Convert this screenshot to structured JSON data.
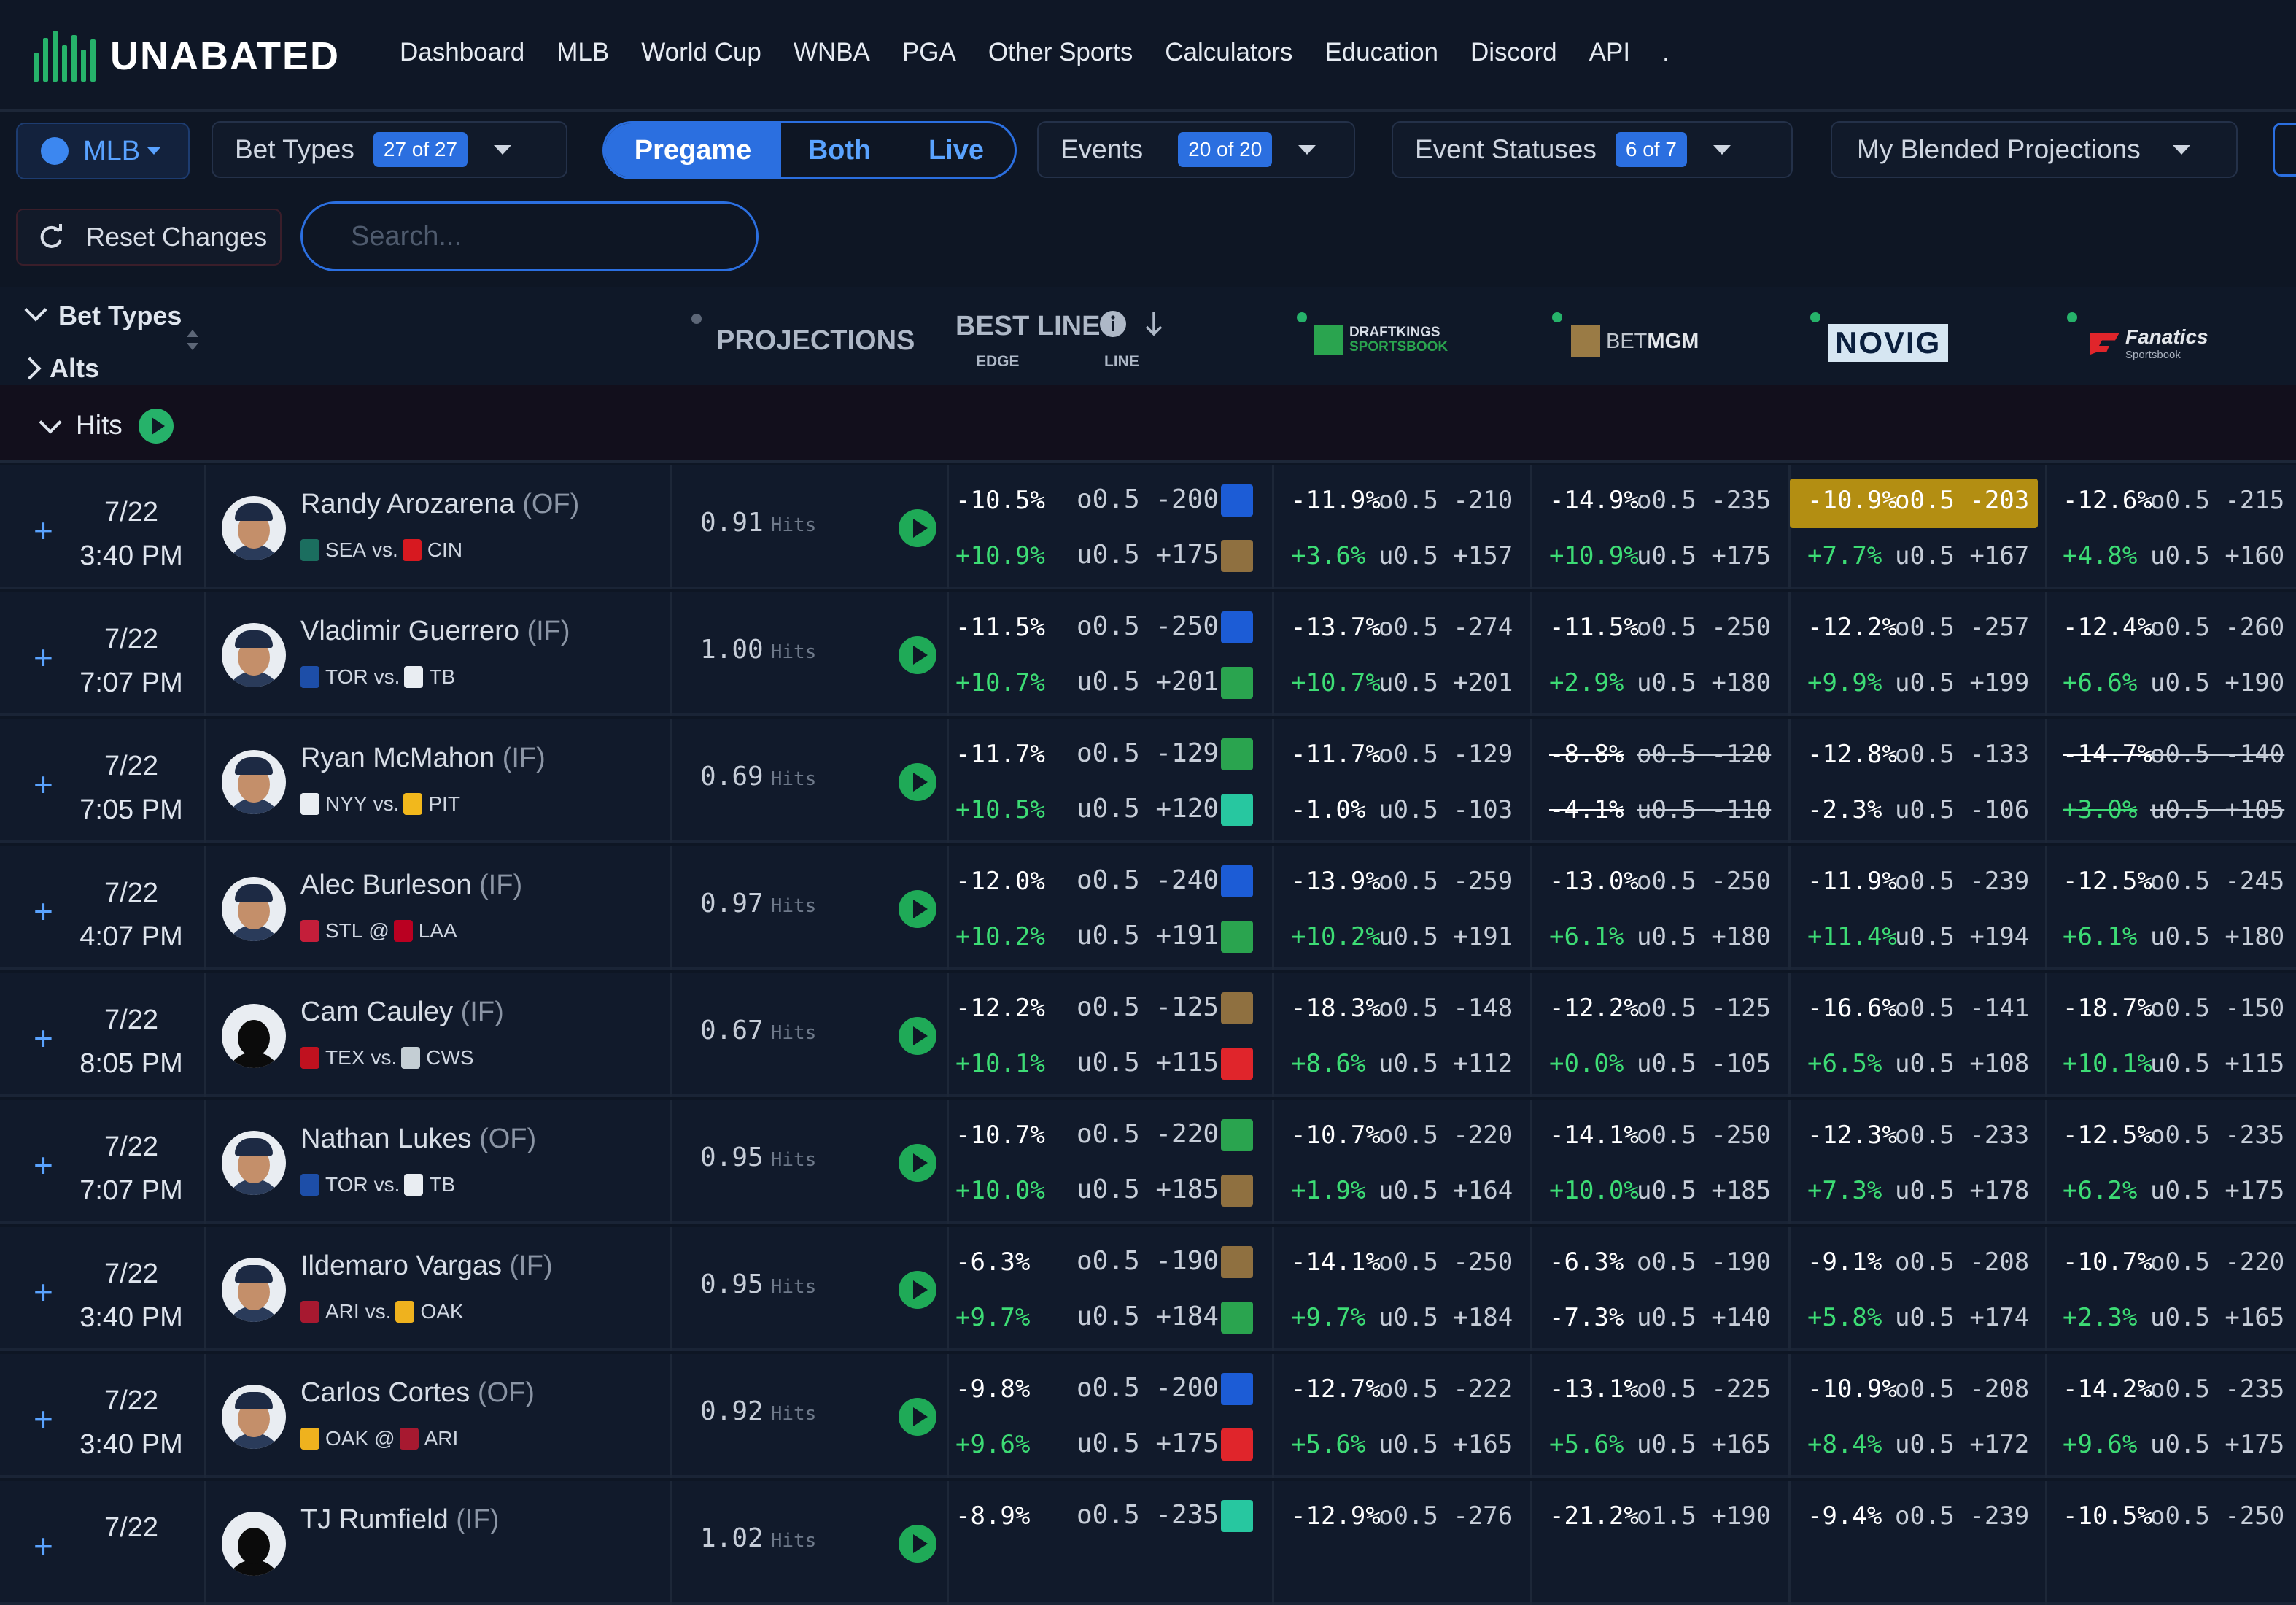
{
  "brand": {
    "name": "UNABATED"
  },
  "nav": [
    "Dashboard",
    "MLB",
    "World Cup",
    "WNBA",
    "PGA",
    "Other Sports",
    "Calculators",
    "Education",
    "Discord",
    "API",
    "."
  ],
  "filters": {
    "sport": "MLB",
    "bet_types": {
      "label": "Bet Types",
      "badge": "27 of 27"
    },
    "mode": {
      "pregame": "Pregame",
      "both": "Both",
      "live": "Live",
      "selected": "Pregame"
    },
    "events": {
      "label": "Events",
      "badge": "20 of 20"
    },
    "statuses": {
      "label": "Event Statuses",
      "badge": "6 of 7"
    },
    "blend": {
      "label": "My Blended Projections"
    },
    "reset": "Reset Changes",
    "search_placeholder": "Search..."
  },
  "header": {
    "bet_types": "Bet Types",
    "alts": "Alts",
    "projections": "PROJECTIONS",
    "best_line": "BEST LINE",
    "edge": "EDGE",
    "line": "LINE",
    "books": {
      "draftkings": {
        "name": "DRAFTKINGS",
        "sub": "SPORTSBOOK"
      },
      "betmgm": {
        "a": "BET",
        "b": "MGM"
      },
      "novig": "NOVIG",
      "fanatics": {
        "name": "Fanatics",
        "sub": "Sportsbook"
      }
    }
  },
  "group": {
    "label": "Hits"
  },
  "colors": {
    "accent": "#2b6fe0",
    "green": "#3ddc75",
    "highlight": "#b38e12"
  },
  "rows": [
    {
      "date": "7/22",
      "time": "3:40 PM",
      "name": "Randy Arozarena",
      "pos": "(OF)",
      "team": "SEA",
      "sep": "vs.",
      "opp": "CIN",
      "proj": "0.91",
      "unit": "Hits",
      "best": {
        "o_edge": "-10.5%",
        "o_line": "o0.5 -200",
        "o_book": "caesars",
        "u_edge": "+10.9%",
        "u_line": "u0.5 +175",
        "u_book": "betmgm"
      },
      "dk": {
        "o_edge": "-11.9%",
        "o_line": "o0.5 -210",
        "u_edge": "+3.6%",
        "u_line": "u0.5 +157"
      },
      "mgm": {
        "o_edge": "-14.9%",
        "o_line": "o0.5 -235",
        "u_edge": "+10.9%",
        "u_line": "u0.5 +175"
      },
      "novig": {
        "o_edge": "-10.9%",
        "o_line": "o0.5 -203",
        "u_edge": "+7.7%",
        "u_line": "u0.5 +167",
        "highlight_over": true
      },
      "fan": {
        "o_edge": "-12.6%",
        "o_line": "o0.5 -215",
        "u_edge": "+4.8%",
        "u_line": "u0.5 +160"
      }
    },
    {
      "date": "7/22",
      "time": "7:07 PM",
      "name": "Vladimir Guerrero",
      "pos": "(IF)",
      "team": "TOR",
      "sep": "vs.",
      "opp": "TB",
      "proj": "1.00",
      "unit": "Hits",
      "best": {
        "o_edge": "-11.5%",
        "o_line": "o0.5 -250",
        "o_book": "caesars",
        "u_edge": "+10.7%",
        "u_line": "u0.5 +201",
        "u_book": "draftkings"
      },
      "dk": {
        "o_edge": "-13.7%",
        "o_line": "o0.5 -274",
        "u_edge": "+10.7%",
        "u_line": "u0.5 +201"
      },
      "mgm": {
        "o_edge": "-11.5%",
        "o_line": "o0.5 -250",
        "u_edge": "+2.9%",
        "u_line": "u0.5 +180"
      },
      "novig": {
        "o_edge": "-12.2%",
        "o_line": "o0.5 -257",
        "u_edge": "+9.9%",
        "u_line": "u0.5 +199"
      },
      "fan": {
        "o_edge": "-12.4%",
        "o_line": "o0.5 -260",
        "u_edge": "+6.6%",
        "u_line": "u0.5 +190"
      }
    },
    {
      "date": "7/22",
      "time": "7:05 PM",
      "name": "Ryan McMahon",
      "pos": "(IF)",
      "team": "NYY",
      "sep": "vs.",
      "opp": "PIT",
      "proj": "0.69",
      "unit": "Hits",
      "best": {
        "o_edge": "-11.7%",
        "o_line": "o0.5 -129",
        "o_book": "draftkings",
        "u_edge": "+10.5%",
        "u_line": "u0.5 +120",
        "u_book": "novig"
      },
      "dk": {
        "o_edge": "-11.7%",
        "o_line": "o0.5 -129",
        "u_edge": "-1.0%",
        "u_line": "u0.5 -103"
      },
      "mgm": {
        "o_edge": "-8.8%",
        "o_line": "o0.5 -120",
        "u_edge": "-4.1%",
        "u_line": "u0.5 -110",
        "strike": true
      },
      "novig": {
        "o_edge": "-12.8%",
        "o_line": "o0.5 -133",
        "u_edge": "-2.3%",
        "u_line": "u0.5 -106"
      },
      "fan": {
        "o_edge": "-14.7%",
        "o_line": "o0.5 -140",
        "u_edge": "+3.0%",
        "u_line": "u0.5 +105",
        "strike": true
      }
    },
    {
      "date": "7/22",
      "time": "4:07 PM",
      "name": "Alec Burleson",
      "pos": "(IF)",
      "team": "STL",
      "sep": "@",
      "opp": "LAA",
      "proj": "0.97",
      "unit": "Hits",
      "best": {
        "o_edge": "-12.0%",
        "o_line": "o0.5 -240",
        "o_book": "caesars",
        "u_edge": "+10.2%",
        "u_line": "u0.5 +191",
        "u_book": "draftkings"
      },
      "dk": {
        "o_edge": "-13.9%",
        "o_line": "o0.5 -259",
        "u_edge": "+10.2%",
        "u_line": "u0.5 +191"
      },
      "mgm": {
        "o_edge": "-13.0%",
        "o_line": "o0.5 -250",
        "u_edge": "+6.1%",
        "u_line": "u0.5 +180"
      },
      "novig": {
        "o_edge": "-11.9%",
        "o_line": "o0.5 -239",
        "u_edge": "+11.4%",
        "u_line": "u0.5 +194"
      },
      "fan": {
        "o_edge": "-12.5%",
        "o_line": "o0.5 -245",
        "u_edge": "+6.1%",
        "u_line": "u0.5 +180"
      }
    },
    {
      "date": "7/22",
      "time": "8:05 PM",
      "name": "Cam Cauley",
      "pos": "(IF)",
      "team": "TEX",
      "sep": "vs.",
      "opp": "CWS",
      "proj": "0.67",
      "unit": "Hits",
      "best": {
        "o_edge": "-12.2%",
        "o_line": "o0.5 -125",
        "o_book": "betmgm",
        "u_edge": "+10.1%",
        "u_line": "u0.5 +115",
        "u_book": "fanatics"
      },
      "dk": {
        "o_edge": "-18.3%",
        "o_line": "o0.5 -148",
        "u_edge": "+8.6%",
        "u_line": "u0.5 +112"
      },
      "mgm": {
        "o_edge": "-12.2%",
        "o_line": "o0.5 -125",
        "u_edge": "+0.0%",
        "u_line": "u0.5 -105"
      },
      "novig": {
        "o_edge": "-16.6%",
        "o_line": "o0.5 -141",
        "u_edge": "+6.5%",
        "u_line": "u0.5 +108"
      },
      "fan": {
        "o_edge": "-18.7%",
        "o_line": "o0.5 -150",
        "u_edge": "+10.1%",
        "u_line": "u0.5 +115"
      }
    },
    {
      "date": "7/22",
      "time": "7:07 PM",
      "name": "Nathan Lukes",
      "pos": "(OF)",
      "team": "TOR",
      "sep": "vs.",
      "opp": "TB",
      "proj": "0.95",
      "unit": "Hits",
      "best": {
        "o_edge": "-10.7%",
        "o_line": "o0.5 -220",
        "o_book": "draftkings",
        "u_edge": "+10.0%",
        "u_line": "u0.5 +185",
        "u_book": "betmgm"
      },
      "dk": {
        "o_edge": "-10.7%",
        "o_line": "o0.5 -220",
        "u_edge": "+1.9%",
        "u_line": "u0.5 +164"
      },
      "mgm": {
        "o_edge": "-14.1%",
        "o_line": "o0.5 -250",
        "u_edge": "+10.0%",
        "u_line": "u0.5 +185"
      },
      "novig": {
        "o_edge": "-12.3%",
        "o_line": "o0.5 -233",
        "u_edge": "+7.3%",
        "u_line": "u0.5 +178"
      },
      "fan": {
        "o_edge": "-12.5%",
        "o_line": "o0.5 -235",
        "u_edge": "+6.2%",
        "u_line": "u0.5 +175"
      }
    },
    {
      "date": "7/22",
      "time": "3:40 PM",
      "name": "Ildemaro Vargas",
      "pos": "(IF)",
      "team": "ARI",
      "sep": "vs.",
      "opp": "OAK",
      "proj": "0.95",
      "unit": "Hits",
      "best": {
        "o_edge": "-6.3%",
        "o_line": "o0.5 -190",
        "o_book": "betmgm",
        "u_edge": "+9.7%",
        "u_line": "u0.5 +184",
        "u_book": "draftkings"
      },
      "dk": {
        "o_edge": "-14.1%",
        "o_line": "o0.5 -250",
        "u_edge": "+9.7%",
        "u_line": "u0.5 +184"
      },
      "mgm": {
        "o_edge": "-6.3%",
        "o_line": "o0.5 -190",
        "u_edge": "-7.3%",
        "u_line": "u0.5 +140"
      },
      "novig": {
        "o_edge": "-9.1%",
        "o_line": "o0.5 -208",
        "u_edge": "+5.8%",
        "u_line": "u0.5 +174"
      },
      "fan": {
        "o_edge": "-10.7%",
        "o_line": "o0.5 -220",
        "u_edge": "+2.3%",
        "u_line": "u0.5 +165"
      }
    },
    {
      "date": "7/22",
      "time": "3:40 PM",
      "name": "Carlos Cortes",
      "pos": "(OF)",
      "team": "OAK",
      "sep": "@",
      "opp": "ARI",
      "proj": "0.92",
      "unit": "Hits",
      "best": {
        "o_edge": "-9.8%",
        "o_line": "o0.5 -200",
        "o_book": "caesars",
        "u_edge": "+9.6%",
        "u_line": "u0.5 +175",
        "u_book": "fanatics"
      },
      "dk": {
        "o_edge": "-12.7%",
        "o_line": "o0.5 -222",
        "u_edge": "+5.6%",
        "u_line": "u0.5 +165"
      },
      "mgm": {
        "o_edge": "-13.1%",
        "o_line": "o0.5 -225",
        "u_edge": "+5.6%",
        "u_line": "u0.5 +165"
      },
      "novig": {
        "o_edge": "-10.9%",
        "o_line": "o0.5 -208",
        "u_edge": "+8.4%",
        "u_line": "u0.5 +172"
      },
      "fan": {
        "o_edge": "-14.2%",
        "o_line": "o0.5 -235",
        "u_edge": "+9.6%",
        "u_line": "u0.5 +175"
      }
    },
    {
      "date": "7/22",
      "time": "",
      "name": "TJ Rumfield",
      "pos": "(IF)",
      "team": "",
      "sep": "",
      "opp": "",
      "proj": "1.02",
      "unit": "Hits",
      "best": {
        "o_edge": "-8.9%",
        "o_line": "o0.5 -235",
        "o_book": "novig",
        "u_edge": "",
        "u_line": "",
        "u_book": ""
      },
      "dk": {
        "o_edge": "-12.9%",
        "o_line": "o0.5 -276",
        "u_edge": "",
        "u_line": ""
      },
      "mgm": {
        "o_edge": "-21.2%",
        "o_line": "o1.5 +190",
        "u_edge": "",
        "u_line": ""
      },
      "novig": {
        "o_edge": "-9.4%",
        "o_line": "o0.5 -239",
        "u_edge": "",
        "u_line": ""
      },
      "fan": {
        "o_edge": "-10.5%",
        "o_line": "o0.5 -250",
        "u_edge": "",
        "u_line": ""
      }
    }
  ]
}
